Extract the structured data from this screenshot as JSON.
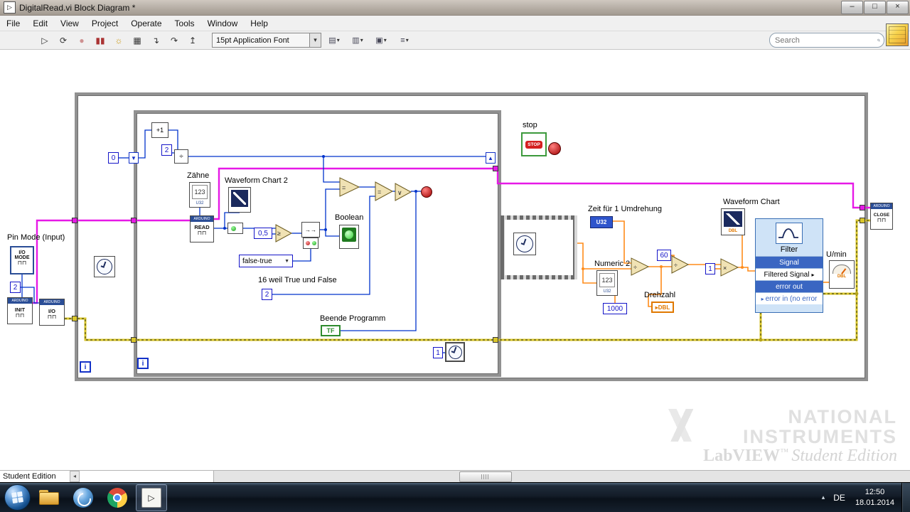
{
  "window": {
    "title": "DigitalRead.vi Block Diagram *",
    "minimize": "–",
    "maximize": "□",
    "close": "×"
  },
  "menubar": {
    "items": [
      "File",
      "Edit",
      "View",
      "Project",
      "Operate",
      "Tools",
      "Window",
      "Help"
    ]
  },
  "toolbar": {
    "run": "▷",
    "run_cont": "⟳",
    "abort": "●",
    "pause": "▮▮",
    "highlight": "☼",
    "retain": "▦",
    "step_into": "↴",
    "step_over": "↷",
    "step_out": "↥",
    "font": "15pt Application Font",
    "caret": "▾",
    "align": "▤",
    "distribute": "▥",
    "resize": "▣",
    "reorder": "≡",
    "search_placeholder": "Search",
    "help": "?"
  },
  "diagram": {
    "labels": {
      "pin_mode": "Pin Mode (Input)",
      "zaehne": "Zähne",
      "wfchart2": "Waveform Chart 2",
      "boolean": "Boolean",
      "sixteen": "16 weil True und False",
      "beende": "Beende Programm",
      "stop": "stop",
      "zeit": "Zeit für 1 Umdrehung",
      "numeric2": "Numeric 2",
      "drehzahl": "Drehzahl",
      "wfchart": "Waveform Chart",
      "umin": "U/min"
    },
    "consts": {
      "zero": "0",
      "two": "2",
      "half": "0,5",
      "thousand": "1000",
      "sixty": "60",
      "one": "1"
    },
    "nodes": {
      "io_mode_line1": "I/O",
      "io_mode_line2": "MODE",
      "arduino": "ARDUINO",
      "init": "INIT",
      "io": "I/O",
      "read": "READ",
      "stop_btn": "STOP",
      "close": "CLOSE",
      "tf": "TF",
      "num123": "123",
      "u32": "U32",
      "dbl": "DBL",
      "enum_ft": "false-true",
      "enum_arrow": "▼",
      "loop_i": "i",
      "sr_down": "▼",
      "sr_up": "▲",
      "plus1": "+1",
      "wave": "⊓⊓",
      "arrows": "→→",
      "row_arrow": "▸"
    },
    "ops": {
      "ge": "≥",
      "eq": "=",
      "or": "∨",
      "div": "÷",
      "mult": "×"
    },
    "filter": {
      "title": "Filter",
      "rows": [
        "Signal",
        "Filtered Signal",
        "error out",
        "error in (no error"
      ]
    }
  },
  "statusbar": {
    "edition": "Student Edition",
    "left_arrow": "◂"
  },
  "watermark": {
    "brand1": "NATIONAL",
    "brand2": "INSTRUMENTS",
    "product": "LabVIEW",
    "tm": "™",
    "edition": "Student Edition"
  },
  "taskbar": {
    "lang": "DE",
    "time": "12:50",
    "date": "18.01.2014",
    "tray_arrow": "▴"
  }
}
